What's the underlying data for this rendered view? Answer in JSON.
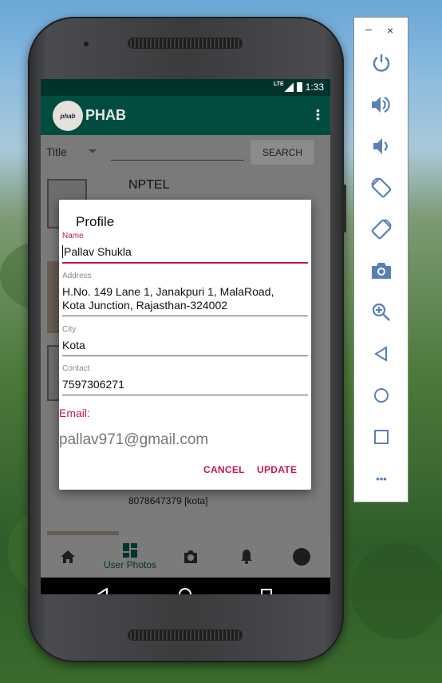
{
  "status_bar": {
    "network": "LTE",
    "time": "1:33"
  },
  "app_bar": {
    "logo_text": "phab",
    "title": "PHAB"
  },
  "search": {
    "filter_label": "Title",
    "button_label": "SEARCH"
  },
  "list": {
    "visible_title": "NPTEL",
    "visible_contact": "8078647379 [kota]"
  },
  "bottom_nav": {
    "active_label": "User Photos"
  },
  "dialog": {
    "title": "Profile",
    "fields": [
      {
        "label": "Name",
        "value": "Pallav Shukla"
      },
      {
        "label": "Address",
        "value": "H.No. 149 Lane 1, Janakpuri 1, MalaRoad,",
        "value_line2": "Kota Junction, Rajasthan-324002"
      },
      {
        "label": "City",
        "value": "Kota"
      },
      {
        "label": "Contact",
        "value": "7597306271"
      }
    ],
    "email_label": "Email:",
    "email_value": "pallav971@gmail.com",
    "cancel_label": "CANCEL",
    "update_label": "UPDATE"
  },
  "emulator_panel": {
    "minimize_glyph": "–",
    "close_glyph": "×",
    "more_glyph": "•••"
  },
  "colors": {
    "app_bar": "#004d40",
    "status_bar": "#00332b",
    "accent": "#c2185b",
    "panel_icon": "#5a7fb8"
  }
}
